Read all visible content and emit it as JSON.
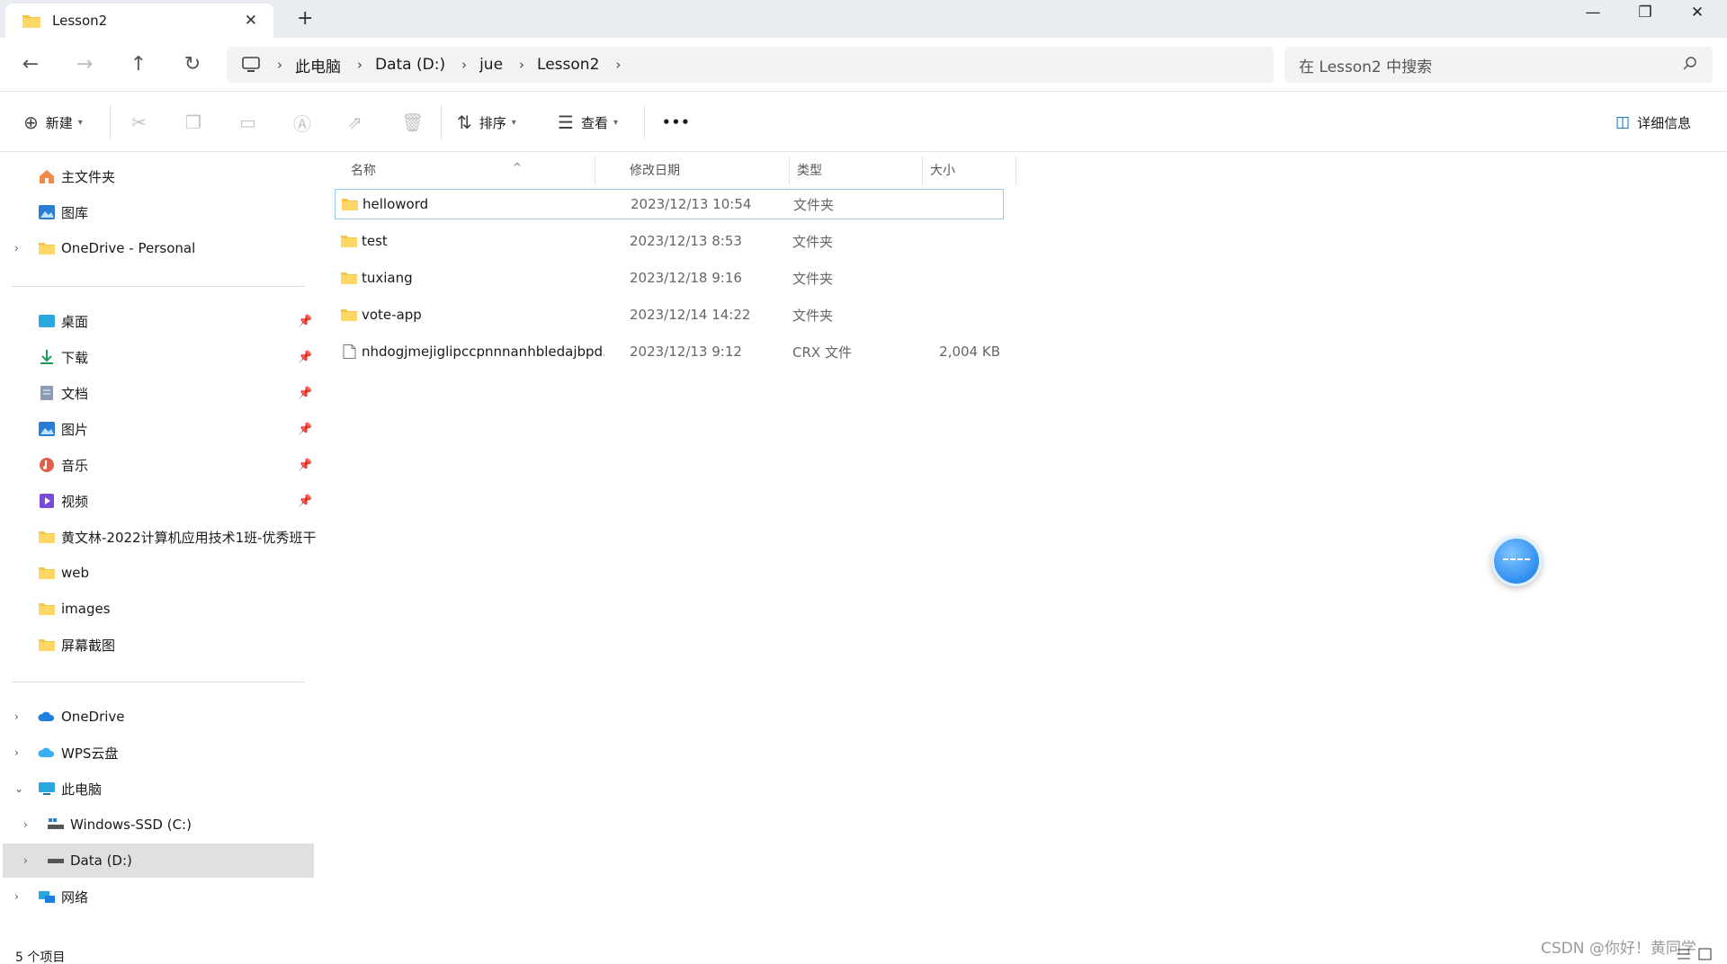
{
  "window": {
    "tab_title": "Lesson2",
    "tab_close_icon": "close-icon",
    "new_tab_symbol": "+"
  },
  "nav": {
    "breadcrumbs": [
      "此电脑",
      "Data (D:)",
      "jue",
      "Lesson2"
    ],
    "search_placeholder": "在 Lesson2 中搜索"
  },
  "toolbar": {
    "new_label": "新建",
    "sort_label": "排序",
    "view_label": "查看",
    "more_label": "•••",
    "details_label": "详细信息"
  },
  "sidebar": {
    "quick": [
      {
        "label": "主文件夹",
        "icon": "home-icon"
      },
      {
        "label": "图库",
        "icon": "gallery-icon"
      },
      {
        "label": "OneDrive - Personal",
        "icon": "folder-icon"
      }
    ],
    "pinned": [
      {
        "label": "桌面",
        "icon": "desktop-icon"
      },
      {
        "label": "下载",
        "icon": "download-icon"
      },
      {
        "label": "文档",
        "icon": "documents-icon"
      },
      {
        "label": "图片",
        "icon": "pictures-icon"
      },
      {
        "label": "音乐",
        "icon": "music-icon"
      },
      {
        "label": "视频",
        "icon": "videos-icon"
      },
      {
        "label": "黄文林-2022计算机应用技术1班-优秀班干",
        "icon": "folder-icon"
      },
      {
        "label": "web",
        "icon": "folder-icon"
      },
      {
        "label": "images",
        "icon": "folder-icon"
      },
      {
        "label": "屏幕截图",
        "icon": "folder-icon"
      }
    ],
    "devices": [
      {
        "label": "OneDrive",
        "icon": "cloud-icon"
      },
      {
        "label": "WPS云盘",
        "icon": "wps-cloud-icon"
      },
      {
        "label": "此电脑",
        "icon": "computer-icon"
      },
      {
        "label": "Windows-SSD (C:)",
        "icon": "drive-icon"
      },
      {
        "label": "Data (D:)",
        "icon": "drive-icon"
      },
      {
        "label": "网络",
        "icon": "network-icon"
      }
    ]
  },
  "filelist": {
    "columns": {
      "name": "名称",
      "date": "修改日期",
      "type": "类型",
      "size": "大小"
    },
    "rows": [
      {
        "name": "helloword",
        "date": "2023/12/13 10:54",
        "type": "文件夹",
        "size": "",
        "icon": "folder-icon"
      },
      {
        "name": "test",
        "date": "2023/12/13 8:53",
        "type": "文件夹",
        "size": "",
        "icon": "folder-icon"
      },
      {
        "name": "tuxiang",
        "date": "2023/12/18 9:16",
        "type": "文件夹",
        "size": "",
        "icon": "folder-icon"
      },
      {
        "name": "vote-app",
        "date": "2023/12/14 14:22",
        "type": "文件夹",
        "size": "",
        "icon": "folder-icon"
      },
      {
        "name": "nhdogjmejiglipccpnnnanhbledajbpd...",
        "date": "2023/12/13 9:12",
        "type": "CRX 文件",
        "size": "2,004 KB",
        "icon": "file-icon"
      }
    ]
  },
  "status": {
    "item_count": "5 个项目",
    "watermark": "CSDN @你好！黄同学"
  },
  "colors": {
    "accent": "#0067c0",
    "folder": "#f6c343",
    "selected_border": "#99c9ef",
    "titlebar_bg": "#e9ecf1"
  }
}
